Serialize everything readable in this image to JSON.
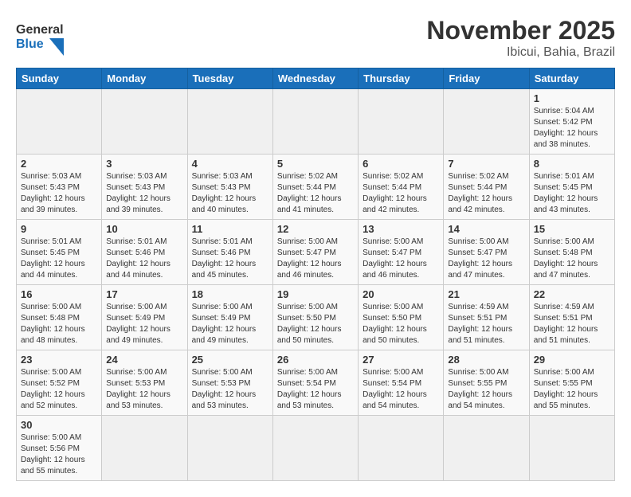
{
  "header": {
    "logo_general": "General",
    "logo_blue": "Blue",
    "month_title": "November 2025",
    "location": "Ibicui, Bahia, Brazil"
  },
  "weekdays": [
    "Sunday",
    "Monday",
    "Tuesday",
    "Wednesday",
    "Thursday",
    "Friday",
    "Saturday"
  ],
  "weeks": [
    [
      {
        "day": "",
        "info": ""
      },
      {
        "day": "",
        "info": ""
      },
      {
        "day": "",
        "info": ""
      },
      {
        "day": "",
        "info": ""
      },
      {
        "day": "",
        "info": ""
      },
      {
        "day": "",
        "info": ""
      },
      {
        "day": "1",
        "info": "Sunrise: 5:04 AM\nSunset: 5:42 PM\nDaylight: 12 hours\nand 38 minutes."
      }
    ],
    [
      {
        "day": "2",
        "info": "Sunrise: 5:03 AM\nSunset: 5:43 PM\nDaylight: 12 hours\nand 39 minutes."
      },
      {
        "day": "3",
        "info": "Sunrise: 5:03 AM\nSunset: 5:43 PM\nDaylight: 12 hours\nand 39 minutes."
      },
      {
        "day": "4",
        "info": "Sunrise: 5:03 AM\nSunset: 5:43 PM\nDaylight: 12 hours\nand 40 minutes."
      },
      {
        "day": "5",
        "info": "Sunrise: 5:02 AM\nSunset: 5:44 PM\nDaylight: 12 hours\nand 41 minutes."
      },
      {
        "day": "6",
        "info": "Sunrise: 5:02 AM\nSunset: 5:44 PM\nDaylight: 12 hours\nand 42 minutes."
      },
      {
        "day": "7",
        "info": "Sunrise: 5:02 AM\nSunset: 5:44 PM\nDaylight: 12 hours\nand 42 minutes."
      },
      {
        "day": "8",
        "info": "Sunrise: 5:01 AM\nSunset: 5:45 PM\nDaylight: 12 hours\nand 43 minutes."
      }
    ],
    [
      {
        "day": "9",
        "info": "Sunrise: 5:01 AM\nSunset: 5:45 PM\nDaylight: 12 hours\nand 44 minutes."
      },
      {
        "day": "10",
        "info": "Sunrise: 5:01 AM\nSunset: 5:46 PM\nDaylight: 12 hours\nand 44 minutes."
      },
      {
        "day": "11",
        "info": "Sunrise: 5:01 AM\nSunset: 5:46 PM\nDaylight: 12 hours\nand 45 minutes."
      },
      {
        "day": "12",
        "info": "Sunrise: 5:00 AM\nSunset: 5:47 PM\nDaylight: 12 hours\nand 46 minutes."
      },
      {
        "day": "13",
        "info": "Sunrise: 5:00 AM\nSunset: 5:47 PM\nDaylight: 12 hours\nand 46 minutes."
      },
      {
        "day": "14",
        "info": "Sunrise: 5:00 AM\nSunset: 5:47 PM\nDaylight: 12 hours\nand 47 minutes."
      },
      {
        "day": "15",
        "info": "Sunrise: 5:00 AM\nSunset: 5:48 PM\nDaylight: 12 hours\nand 47 minutes."
      }
    ],
    [
      {
        "day": "16",
        "info": "Sunrise: 5:00 AM\nSunset: 5:48 PM\nDaylight: 12 hours\nand 48 minutes."
      },
      {
        "day": "17",
        "info": "Sunrise: 5:00 AM\nSunset: 5:49 PM\nDaylight: 12 hours\nand 49 minutes."
      },
      {
        "day": "18",
        "info": "Sunrise: 5:00 AM\nSunset: 5:49 PM\nDaylight: 12 hours\nand 49 minutes."
      },
      {
        "day": "19",
        "info": "Sunrise: 5:00 AM\nSunset: 5:50 PM\nDaylight: 12 hours\nand 50 minutes."
      },
      {
        "day": "20",
        "info": "Sunrise: 5:00 AM\nSunset: 5:50 PM\nDaylight: 12 hours\nand 50 minutes."
      },
      {
        "day": "21",
        "info": "Sunrise: 4:59 AM\nSunset: 5:51 PM\nDaylight: 12 hours\nand 51 minutes."
      },
      {
        "day": "22",
        "info": "Sunrise: 4:59 AM\nSunset: 5:51 PM\nDaylight: 12 hours\nand 51 minutes."
      }
    ],
    [
      {
        "day": "23",
        "info": "Sunrise: 5:00 AM\nSunset: 5:52 PM\nDaylight: 12 hours\nand 52 minutes."
      },
      {
        "day": "24",
        "info": "Sunrise: 5:00 AM\nSunset: 5:53 PM\nDaylight: 12 hours\nand 53 minutes."
      },
      {
        "day": "25",
        "info": "Sunrise: 5:00 AM\nSunset: 5:53 PM\nDaylight: 12 hours\nand 53 minutes."
      },
      {
        "day": "26",
        "info": "Sunrise: 5:00 AM\nSunset: 5:54 PM\nDaylight: 12 hours\nand 53 minutes."
      },
      {
        "day": "27",
        "info": "Sunrise: 5:00 AM\nSunset: 5:54 PM\nDaylight: 12 hours\nand 54 minutes."
      },
      {
        "day": "28",
        "info": "Sunrise: 5:00 AM\nSunset: 5:55 PM\nDaylight: 12 hours\nand 54 minutes."
      },
      {
        "day": "29",
        "info": "Sunrise: 5:00 AM\nSunset: 5:55 PM\nDaylight: 12 hours\nand 55 minutes."
      }
    ],
    [
      {
        "day": "30",
        "info": "Sunrise: 5:00 AM\nSunset: 5:56 PM\nDaylight: 12 hours\nand 55 minutes."
      },
      {
        "day": "",
        "info": ""
      },
      {
        "day": "",
        "info": ""
      },
      {
        "day": "",
        "info": ""
      },
      {
        "day": "",
        "info": ""
      },
      {
        "day": "",
        "info": ""
      },
      {
        "day": "",
        "info": ""
      }
    ]
  ]
}
